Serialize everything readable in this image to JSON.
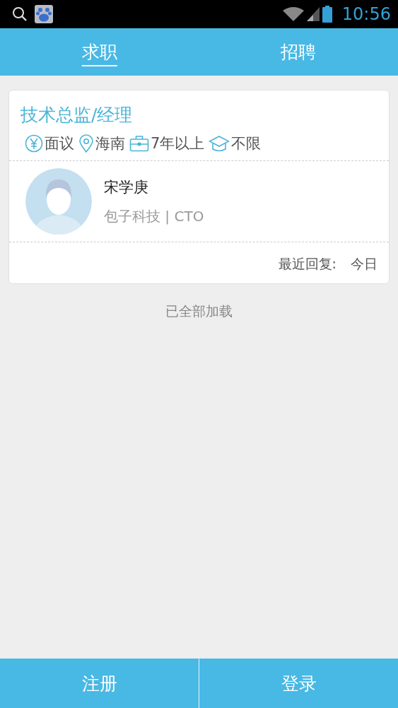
{
  "status_bar": {
    "time": "10:56"
  },
  "tabs": [
    {
      "label": "求职",
      "selected": true
    },
    {
      "label": "招聘",
      "selected": false
    }
  ],
  "jobs": [
    {
      "title": "技术总监/经理",
      "tags": [
        {
          "kind": "salary",
          "text": "面议"
        },
        {
          "kind": "location",
          "text": "海南"
        },
        {
          "kind": "experience",
          "text": "7年以上"
        },
        {
          "kind": "education",
          "text": "不限"
        }
      ],
      "person": {
        "name": "宋学庚",
        "company": "包子科技 | CTO"
      },
      "reply_label": "最近回复:",
      "reply_time": "今日"
    }
  ],
  "footer_note": "已全部加载",
  "bottom_buttons": [
    "注册",
    "登录"
  ]
}
